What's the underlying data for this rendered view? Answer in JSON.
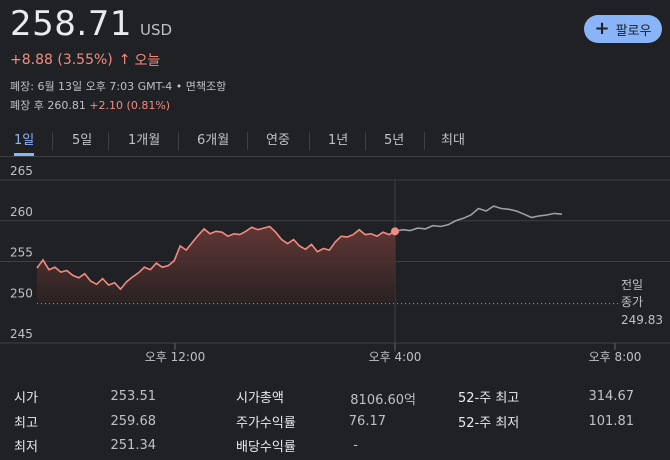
{
  "quote": {
    "price": "258.71",
    "currency": "USD",
    "change": "+8.88 (3.55%)",
    "change_arrow": "↑",
    "change_period": "오늘",
    "close_info": "폐장: 6월 13일 오후 7:03 GMT-4 • 면책조항",
    "after_hours_label": "폐장 후 260.81",
    "after_hours_change": "+2.10 (0.81%)"
  },
  "follow_button": {
    "icon": "plus-icon",
    "label": "팔로우"
  },
  "tabs": [
    {
      "label": "1일",
      "active": true
    },
    {
      "label": "5일"
    },
    {
      "label": "1개월"
    },
    {
      "label": "6개월"
    },
    {
      "label": "연중"
    },
    {
      "label": "1년"
    },
    {
      "label": "5년"
    },
    {
      "label": "최대"
    }
  ],
  "chart_data": {
    "type": "line",
    "y_ticks": [
      "265",
      "260",
      "255",
      "250",
      "245"
    ],
    "ylim": [
      245,
      265
    ],
    "x_ticks": [
      "오후 12:00",
      "오후 4:00",
      "오후 8:00"
    ],
    "prev_close_label_line1": "전일",
    "prev_close_label_line2": "종가",
    "prev_close_value": "249.83",
    "prev_close": 249.83,
    "colors": {
      "up_line": "#f28b82",
      "after_hours_line": "#9aa0a6",
      "marker": "#f28b82"
    },
    "regular_session": [
      254.2,
      255.2,
      254.0,
      254.3,
      253.7,
      253.9,
      253.3,
      253.0,
      253.5,
      252.6,
      252.2,
      252.9,
      252.1,
      252.4,
      251.6,
      252.5,
      253.1,
      253.6,
      254.3,
      254.0,
      254.8,
      254.3,
      254.5,
      255.1,
      256.9,
      256.4,
      257.3,
      258.2,
      259.0,
      258.4,
      258.7,
      258.6,
      258.1,
      258.4,
      258.3,
      258.7,
      259.2,
      258.9,
      259.1,
      259.3,
      258.6,
      257.7,
      257.2,
      257.7,
      256.9,
      256.5,
      257.1,
      256.2,
      256.6,
      256.4,
      257.4,
      258.1,
      258.0,
      258.3,
      258.9,
      258.3,
      258.4,
      258.1,
      258.6,
      258.3,
      258.7
    ],
    "after_hours": [
      258.7,
      258.9,
      258.8,
      259.1,
      259.0,
      259.4,
      259.3,
      259.5,
      260.0,
      260.3,
      260.7,
      261.5,
      261.2,
      261.8,
      261.5,
      261.4,
      261.2,
      260.8,
      260.4,
      260.6,
      260.7,
      260.9,
      260.8
    ]
  },
  "stats": [
    {
      "label": "시가",
      "value": "253.51"
    },
    {
      "label": "최고",
      "value": "259.68"
    },
    {
      "label": "최저",
      "value": "251.34"
    },
    {
      "label": "시가총액",
      "value": "8106.60억"
    },
    {
      "label": "주가수익률",
      "value": "76.17"
    },
    {
      "label": "배당수익률",
      "value": "-"
    },
    {
      "label": "52-주 최고",
      "value": "314.67"
    },
    {
      "label": "52-주 최저",
      "value": "101.81"
    }
  ]
}
